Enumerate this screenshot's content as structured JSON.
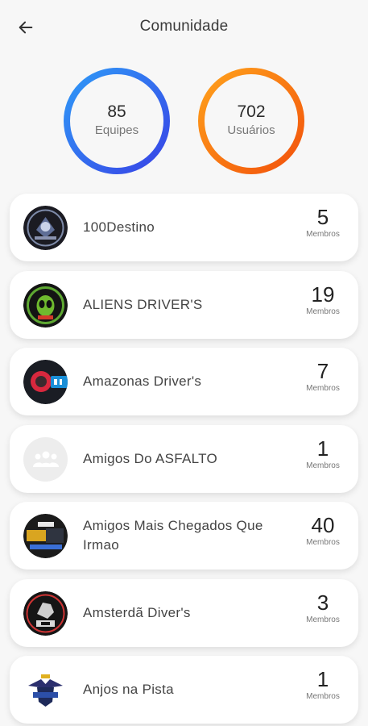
{
  "header": {
    "title": "Comunidade",
    "back_icon": "arrow-left-icon"
  },
  "stats": [
    {
      "value": "85",
      "label": "Equipes",
      "colors": [
        "#2f8cf5",
        "#3b49e8"
      ]
    },
    {
      "value": "702",
      "label": "Usuários",
      "colors": [
        "#ff9a1f",
        "#f25a0c"
      ]
    }
  ],
  "teams": [
    {
      "name": "100Destino",
      "count": "5",
      "count_label": "Membros",
      "avatar": "team-logo-100destino"
    },
    {
      "name": "ALIENS DRIVER'S",
      "count": "19",
      "count_label": "Membros",
      "avatar": "team-logo-aliens"
    },
    {
      "name": "Amazonas Driver's",
      "count": "7",
      "count_label": "Membros",
      "avatar": "team-logo-amazonas"
    },
    {
      "name": "Amigos Do ASFALTO",
      "count": "1",
      "count_label": "Membros",
      "avatar": "group-placeholder-icon"
    },
    {
      "name": "Amigos Mais Chegados Que Irmao",
      "count": "40",
      "count_label": "Membros",
      "avatar": "team-logo-amigos-mais"
    },
    {
      "name": "Amsterdã Diver's",
      "count": "3",
      "count_label": "Membros",
      "avatar": "team-logo-amsterda"
    },
    {
      "name": "Anjos na Pista",
      "count": "1",
      "count_label": "Membros",
      "avatar": "team-logo-anjos"
    }
  ]
}
